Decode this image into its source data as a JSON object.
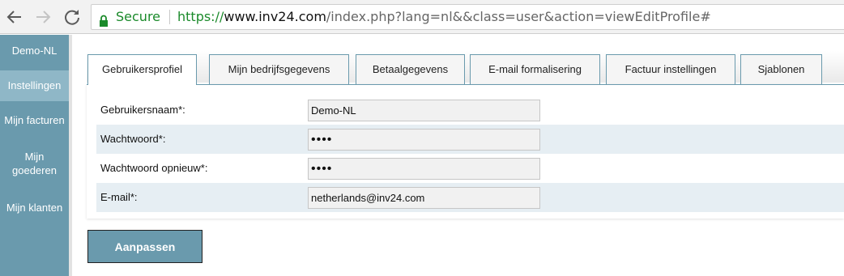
{
  "browser": {
    "secure_label": "Secure",
    "url_scheme": "https://",
    "url_host": "www.inv24.com",
    "url_path": "/index.php?lang=nl&&class=user&action=viewEditProfile#"
  },
  "sidebar": {
    "user": "Demo-NL",
    "items": [
      {
        "label": "Instellingen",
        "active": true
      },
      {
        "label": "Mijn facturen"
      },
      {
        "label": "Mijn goederen"
      },
      {
        "label": "Mijn klanten"
      }
    ]
  },
  "tabs": [
    {
      "label": "Gebruikersprofiel",
      "active": true
    },
    {
      "label": "Mijn bedrijfsgegevens"
    },
    {
      "label": "Betaalgegevens"
    },
    {
      "label": "E-mail formalisering"
    },
    {
      "label": "Factuur instellingen"
    },
    {
      "label": "Sjablonen"
    }
  ],
  "form": {
    "fields": [
      {
        "label": "Gebruikersnaam*:",
        "value": "Demo-NL"
      },
      {
        "label": "Wachtwoord*:",
        "value": "••••"
      },
      {
        "label": "Wachtwoord opnieuw*:",
        "value": "••••"
      },
      {
        "label": "E-mail*:",
        "value": "netherlands@inv24.com"
      }
    ],
    "submit_label": "Aanpassen"
  },
  "colors": {
    "accent": "#6a9aad",
    "sidebar_active": "#8fb7c7",
    "secure_green": "#1a8a2a",
    "row_alt": "#e6eef3"
  },
  "icons": [
    "back-arrow-icon",
    "forward-arrow-icon",
    "reload-icon",
    "lock-icon"
  ]
}
